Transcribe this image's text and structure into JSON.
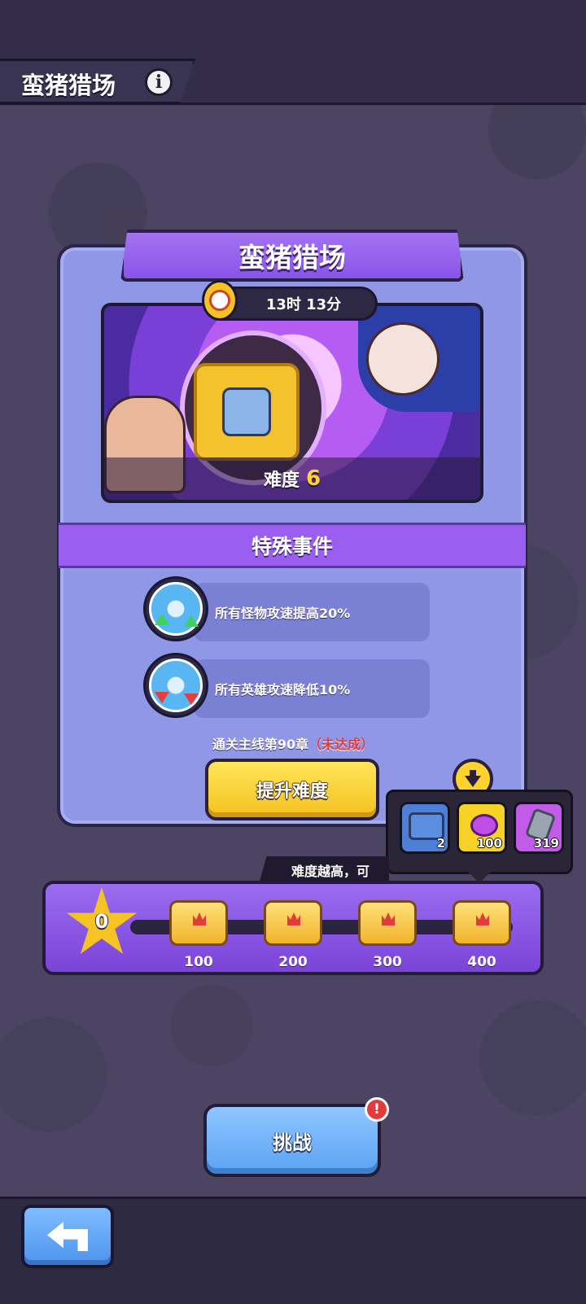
{
  "header": {
    "title": "蛮猪猎场"
  },
  "panel": {
    "title": "蛮猪猎场",
    "timer": "13时 13分",
    "difficulty_label": "难度",
    "difficulty_value": "6"
  },
  "events": {
    "title": "特殊事件",
    "items": [
      {
        "text": "所有怪物攻速提高20%",
        "icon": "monster-attack-speed-up-icon"
      },
      {
        "text": "所有英雄攻速降低10%",
        "icon": "hero-attack-speed-down-icon"
      }
    ]
  },
  "requirement": {
    "text": "通关主线第90章",
    "status": "（未达成）"
  },
  "buttons": {
    "raise_difficulty": "提升难度",
    "challenge": "挑战",
    "alert": "!"
  },
  "reward_popup": {
    "items": [
      {
        "name": "kit",
        "amount": "2"
      },
      {
        "name": "gem",
        "amount": "100"
      },
      {
        "name": "ore",
        "amount": "319"
      }
    ]
  },
  "progress": {
    "hint": "难度越高，可",
    "current": "0",
    "milestones": [
      "100",
      "200",
      "300",
      "400"
    ]
  },
  "colors": {
    "accent_purple": "#9a5ff0",
    "panel_blue": "#8f97e6",
    "gold": "#f6c325",
    "alert_red": "#e23b3b"
  }
}
